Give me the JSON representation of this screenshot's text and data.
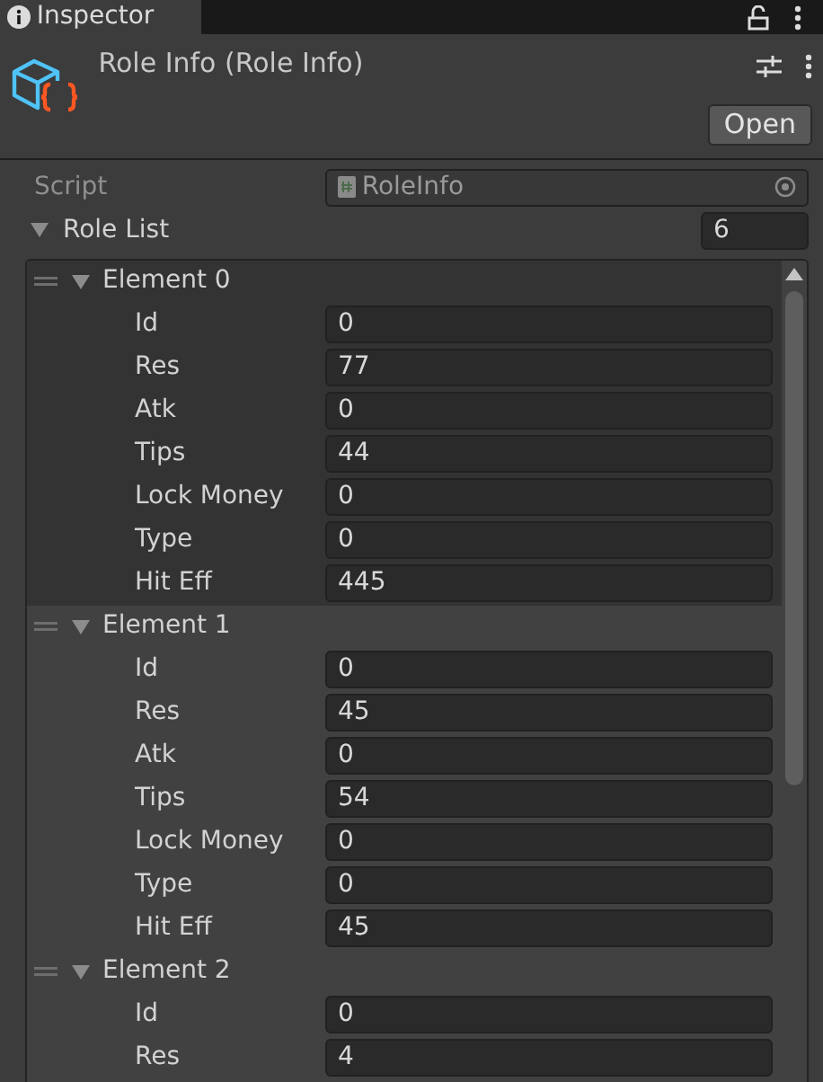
{
  "tab": {
    "label": "Inspector"
  },
  "header": {
    "title": "Role Info (Role Info)",
    "open_button": "Open"
  },
  "script": {
    "label": "Script",
    "value": "RoleInfo"
  },
  "role_list": {
    "label": "Role List",
    "expanded": true,
    "size": "6",
    "elements": [
      {
        "label": "Element 0",
        "expanded": true,
        "selected": true,
        "fields": [
          {
            "label": "Id",
            "value": "0"
          },
          {
            "label": "Res",
            "value": "77"
          },
          {
            "label": "Atk",
            "value": "0"
          },
          {
            "label": "Tips",
            "value": "44"
          },
          {
            "label": "Lock Money",
            "value": "0"
          },
          {
            "label": "Type",
            "value": "0"
          },
          {
            "label": "Hit Eff",
            "value": "445"
          }
        ]
      },
      {
        "label": "Element 1",
        "expanded": true,
        "selected": false,
        "fields": [
          {
            "label": "Id",
            "value": "0"
          },
          {
            "label": "Res",
            "value": "45"
          },
          {
            "label": "Atk",
            "value": "0"
          },
          {
            "label": "Tips",
            "value": "54"
          },
          {
            "label": "Lock Money",
            "value": "0"
          },
          {
            "label": "Type",
            "value": "0"
          },
          {
            "label": "Hit Eff",
            "value": "45"
          }
        ]
      },
      {
        "label": "Element 2",
        "expanded": true,
        "selected": false,
        "fields": [
          {
            "label": "Id",
            "value": "0"
          },
          {
            "label": "Res",
            "value": "4"
          }
        ]
      }
    ]
  }
}
